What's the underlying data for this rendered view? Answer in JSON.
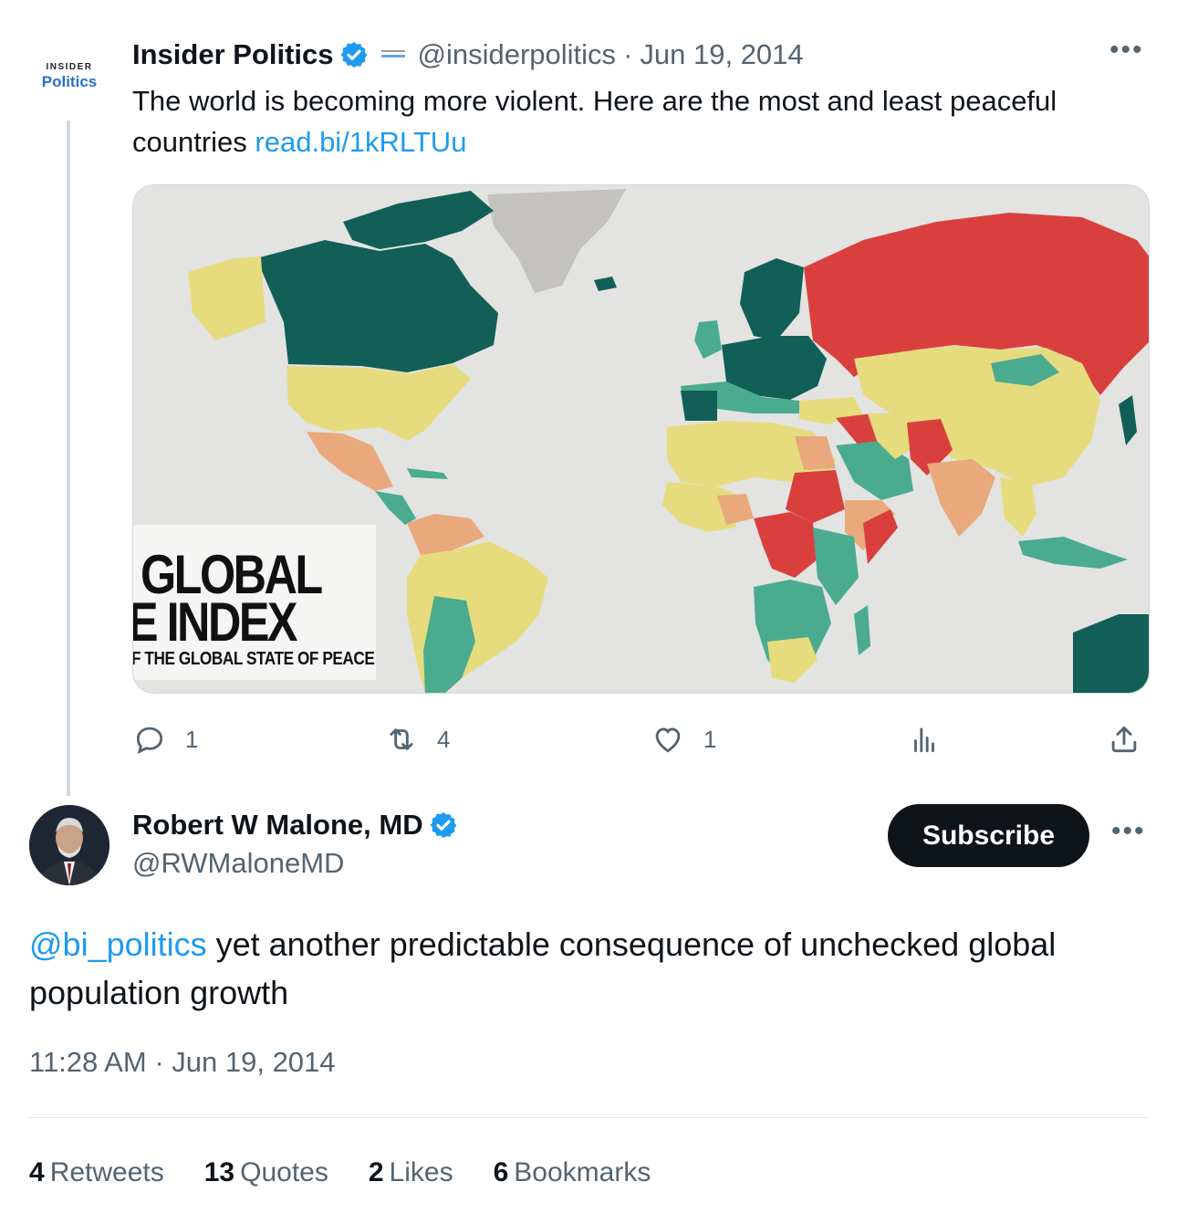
{
  "parent_tweet": {
    "avatar": {
      "top_text": "INSIDER",
      "bottom_text": "Politics"
    },
    "name": "Insider Politics",
    "handle": "@insiderpolitics",
    "separator": "·",
    "date": "Jun 19, 2014",
    "more_label": "•••",
    "text": "The world is becoming more violent. Here are the most and least peaceful countries ",
    "link": "read.bi/1kRLTUu",
    "map_card": {
      "overlay_line1": "GLOBAL",
      "overlay_line2": "E INDEX",
      "overlay_line3": "F THE GLOBAL STATE OF PEACE",
      "colors": {
        "most_peaceful": "#125f57",
        "peaceful": "#4aab8f",
        "medium": "#e6dc7e",
        "low": "#e9a97c",
        "least_peaceful": "#d9403d",
        "no_data": "#c4c2c0",
        "ocean": "#e3e3e1"
      }
    },
    "actions": {
      "reply_count": "1",
      "retweet_count": "4",
      "like_count": "1",
      "reply_icon": "reply-icon",
      "retweet_icon": "retweet-icon",
      "like_icon": "heart-icon",
      "views_icon": "views-icon",
      "share_icon": "share-icon"
    }
  },
  "reply_tweet": {
    "name": "Robert W Malone, MD",
    "handle": "@RWMaloneMD",
    "subscribe_label": "Subscribe",
    "more_label": "•••",
    "mention": "@bi_politics",
    "text": " yet another predictable consequence of unchecked global population growth",
    "time": "11:28 AM",
    "separator": "·",
    "date": "Jun 19, 2014",
    "stats": {
      "retweets_count": "4",
      "retweets_label": "Retweets",
      "quotes_count": "13",
      "quotes_label": "Quotes",
      "likes_count": "2",
      "likes_label": "Likes",
      "bookmarks_count": "6",
      "bookmarks_label": "Bookmarks"
    }
  },
  "colors": {
    "accent_blue": "#1d9bf0",
    "text_primary": "#0f1419",
    "text_secondary": "#536471",
    "verified_badge": "#1d9bf0"
  }
}
